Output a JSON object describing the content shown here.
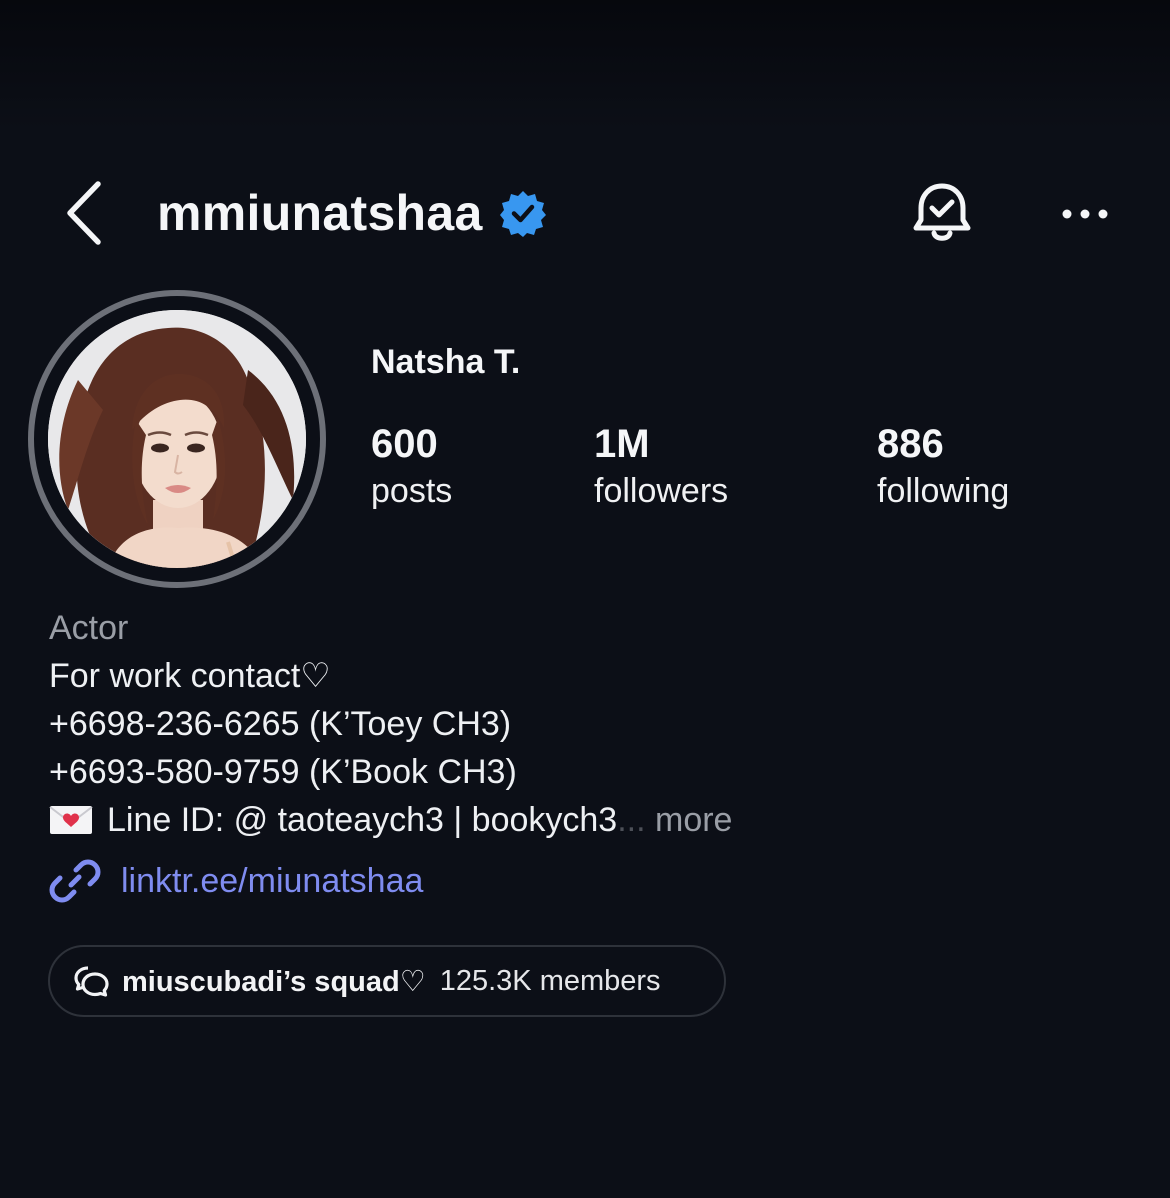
{
  "header": {
    "username": "mmiunatshaa"
  },
  "profile": {
    "display_name": "Natsha T.",
    "stats": {
      "posts_count": "600",
      "posts_label": "posts",
      "followers_count": "1M",
      "followers_label": "followers",
      "following_count": "886",
      "following_label": "following"
    }
  },
  "bio": {
    "category": "Actor",
    "line1": "For work contact♡",
    "line2": "+6698-236-6265 (K’Toey CH3)",
    "line3": "+6693-580-9759 (K’Book CH3)",
    "line4": "Line ID: @ taoteaych3 | bookych3",
    "ellipsis": "...",
    "more_label": " more",
    "link": "linktr.ee/miunatshaa"
  },
  "channel": {
    "name": "miuscubadi’s squad♡",
    "members": "125.3K members"
  },
  "colors": {
    "background": "#0c0f17",
    "verified": "#3897f0",
    "link": "#7f8cf0",
    "secondary_text": "#9a9ea6"
  },
  "icons": {
    "back": "chevron-left-icon",
    "verified": "verified-badge-icon",
    "bell": "bell-check-icon",
    "more": "more-horizontal-icon",
    "envelope": "love-letter-icon",
    "link": "link-icon",
    "channel": "chat-bubbles-icon"
  }
}
